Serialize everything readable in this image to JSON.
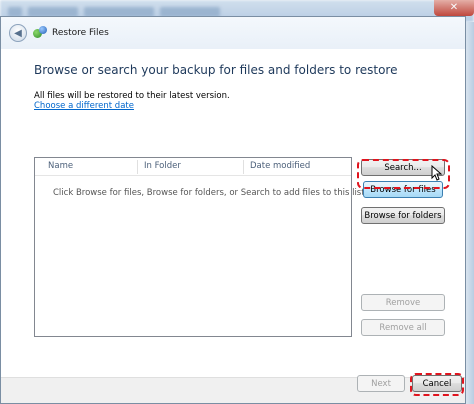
{
  "window": {
    "close_glyph": "✕"
  },
  "dialog": {
    "title": "Restore Files",
    "heading": "Browse or search your backup for files and folders to restore",
    "info": "All files will be restored to their latest version.",
    "link": "Choose a different date"
  },
  "list": {
    "columns": [
      "Name",
      "In Folder",
      "Date modified"
    ],
    "empty_message": "Click Browse for files, Browse for folders, or Search to add files to this list."
  },
  "buttons": {
    "search": "Search...",
    "browse_files": "Browse for files",
    "browse_folders": "Browse for folders",
    "remove": "Remove",
    "remove_all": "Remove all",
    "next": "Next",
    "cancel": "Cancel"
  },
  "icons": {
    "back": "back-arrow-icon",
    "app": "restore-files-icon",
    "cursor": "mouse-pointer-icon"
  },
  "colors": {
    "highlight": "#e0141e",
    "heading": "#1e395b",
    "link": "#0066cc"
  }
}
